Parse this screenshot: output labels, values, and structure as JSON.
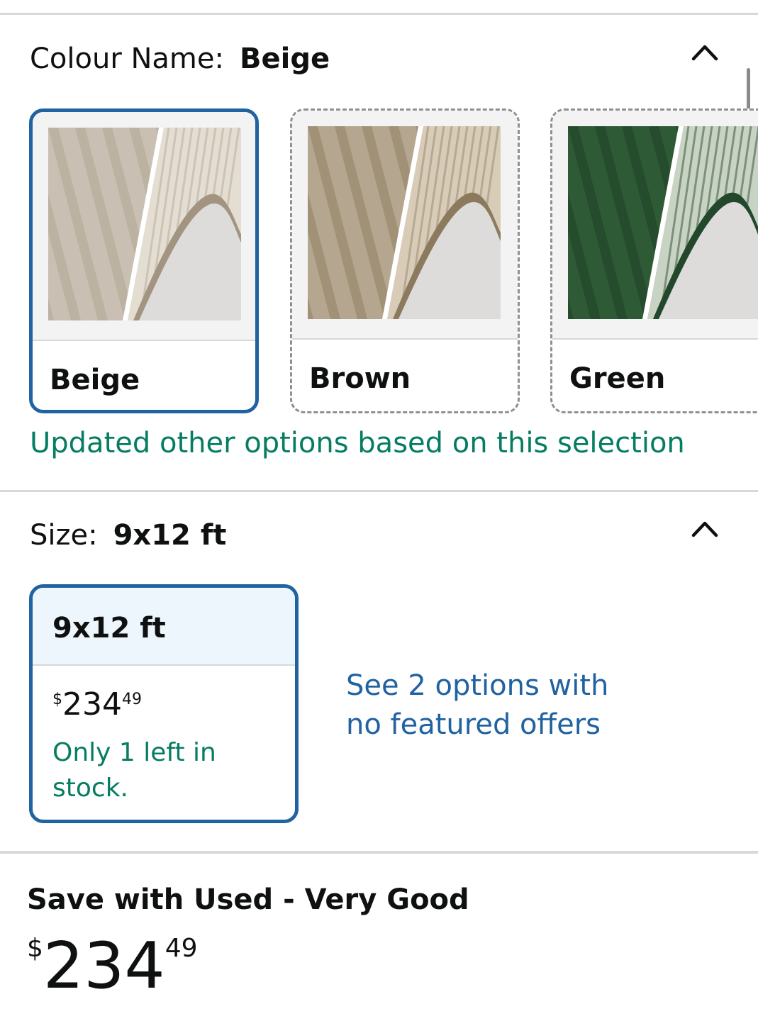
{
  "colour": {
    "label": "Colour Name:",
    "selected_value": "Beige",
    "swatches": [
      {
        "name": "Beige",
        "selected": true,
        "colors": {
          "base": "#c9c0b3",
          "light": "#e4ddd2",
          "pattern": "#b1a593",
          "edge": "#a29480"
        }
      },
      {
        "name": "Brown",
        "selected": false,
        "colors": {
          "base": "#b5a68f",
          "light": "#d8ccb8",
          "pattern": "#8f7f64",
          "edge": "#8c7a5f"
        }
      },
      {
        "name": "Green",
        "selected": false,
        "colors": {
          "base": "#2e5a35",
          "light": "#c8d3c4",
          "pattern": "#1f4226",
          "edge": "#22472a"
        }
      }
    ],
    "update_note": "Updated other options based on this selection"
  },
  "size": {
    "label": "Size:",
    "selected_value": "9x12 ft",
    "option": {
      "name": "9x12 ft",
      "price": {
        "currency": "$",
        "whole": "234",
        "fraction": "49"
      },
      "stock": "Only 1 left in stock."
    },
    "see_options": "See 2 options with no featured offers"
  },
  "used": {
    "title": "Save with Used - Very Good",
    "price": {
      "currency": "$",
      "whole": "234",
      "fraction": "49"
    }
  },
  "theme": {
    "selected_border": "#2162a1",
    "success_green": "#067d62",
    "link_blue": "#2162a1",
    "divider": "#d5d9d9"
  },
  "icons": {
    "collapse": "chevron-up-icon"
  }
}
